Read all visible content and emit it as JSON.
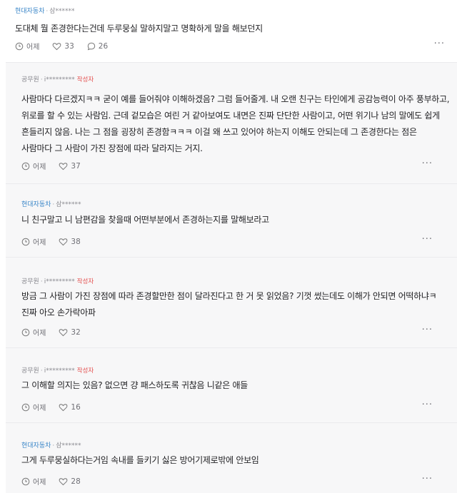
{
  "top": {
    "company": "현대자동차",
    "user": "삼******",
    "text": "도대체 뭘 존경한다는건데 두루뭉실 말하지말고 명확하게 말을 해보던지",
    "time": "어제",
    "likes": "33",
    "comments": "26"
  },
  "replies": [
    {
      "company": "공무원",
      "user": "i*********",
      "badge": "작성자",
      "text": "사람마다 다르겠지ㅋㅋ 굳이 예를 들어줘야 이해하겠음? 그럼 들어줄게. 내 오랜 친구는 타인에게 공감능력이 아주 풍부하고, 위로를 할 수 있는 사람임. 근데 겉모습은 여린 거 같아보여도 내면은 진짜 단단한 사람이고, 어떤 위기나 남의 말에도 쉽게 흔들리지 않음. 나는 그 점을 굉장히 존경함ㅋㅋㅋ 이걸 왜 쓰고 있어야 하는지 이해도 안되는데 그 존경한다는 점은 사람마다 그 사람이 가진 장점에 따라 달라지는 거지.",
      "time": "어제",
      "likes": "37"
    },
    {
      "company": "현대자동차",
      "user": "삼******",
      "badge": "",
      "text": "니 친구말고 니 남편감을 찾을때 어떤부분에서 존경하는지를 말해보라고",
      "time": "어제",
      "likes": "38"
    },
    {
      "company": "공무원",
      "user": "i*********",
      "badge": "작성자",
      "text": "방금 그 사람이 가진 장점에 따라 존경할만한 점이 달라진다고 한 거 못 읽었음? 기껏 썼는데도 이해가 안되면 어떡하냐ㅋ 진짜 아오 손가락아파",
      "time": "어제",
      "likes": "32"
    },
    {
      "company": "공무원",
      "user": "i*********",
      "badge": "작성자",
      "text": "그 이해할 의지는 있음? 없으면 걍 패스하도록 귀찮음 니같은 애들",
      "time": "어제",
      "likes": "16"
    },
    {
      "company": "현대자동차",
      "user": "삼******",
      "badge": "",
      "text": "그게 두루뭉실하다는거임 속내를 들키기 싫은 방어기제로밖에 안보임",
      "time": "어제",
      "likes": "28"
    }
  ],
  "icons": {
    "time": "clock-icon",
    "like": "heart-icon",
    "comment": "speech-bubble-icon",
    "more": "more-dots-icon"
  },
  "colors": {
    "company": "#3a86c8",
    "author_badge": "#e4504f",
    "reply_bg": "#f7f7f8"
  }
}
